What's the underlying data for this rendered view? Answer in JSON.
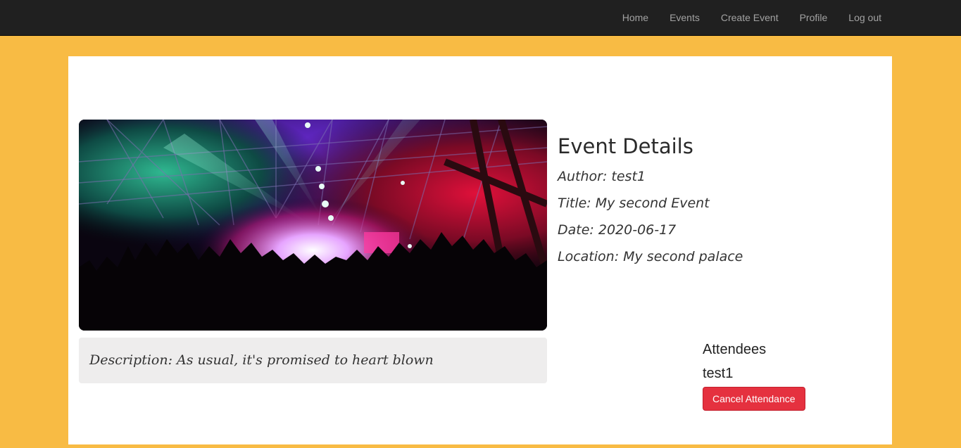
{
  "nav": {
    "items": [
      {
        "label": "Home"
      },
      {
        "label": "Events"
      },
      {
        "label": "Create Event"
      },
      {
        "label": "Profile"
      },
      {
        "label": "Log out"
      }
    ]
  },
  "event": {
    "heading": "Event Details",
    "author": "Author: test1",
    "title": "Title: My second Event",
    "date": "Date: 2020-06-17",
    "location": "Location: My second palace",
    "description": "Description: As usual, it's promised to heart blown",
    "image_alt": "concert-crowd-stage-lights"
  },
  "attendees": {
    "heading": "Attendees",
    "list": [
      "test1"
    ],
    "cancel_label": "Cancel Attendance"
  },
  "colors": {
    "page_bg": "#f8bb44",
    "navbar_bg": "#202020",
    "cancel_button": "#e5313f"
  }
}
